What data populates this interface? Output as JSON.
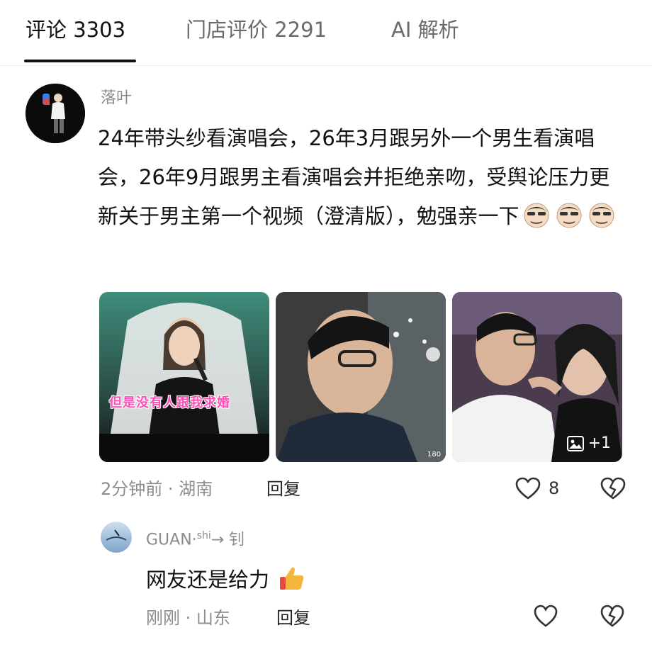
{
  "tabs": [
    {
      "label": "评论 3303"
    },
    {
      "label": "门店评价 2291"
    },
    {
      "label": "AI 解析"
    }
  ],
  "comment": {
    "username": "落叶",
    "text": "24年带头纱看演唱会，26年3月跟另外一个男生看演唱会，26年9月跟男主看演唱会并拒绝亲吻，受舆论压力更新关于男主第一个视频（澄清版），勉强亲一下",
    "images": [
      {
        "caption": "但是没有人跟我求婚"
      },
      {
        "caption": ""
      },
      {
        "more_count": "+1"
      }
    ],
    "meta": "2分钟前 · 湖南",
    "reply_label": "回复",
    "likes": "8",
    "emoji_count": 3
  },
  "reply": {
    "username": "GUAN",
    "username_sup": "shi",
    "username_tail": "→ 钊",
    "text": "网友还是给力",
    "meta": "刚刚 · 山东",
    "reply_label": "回复"
  },
  "colors": {
    "text": "#111111",
    "muted": "#8c8c8c",
    "caption_pink": "#ff4fb8"
  }
}
